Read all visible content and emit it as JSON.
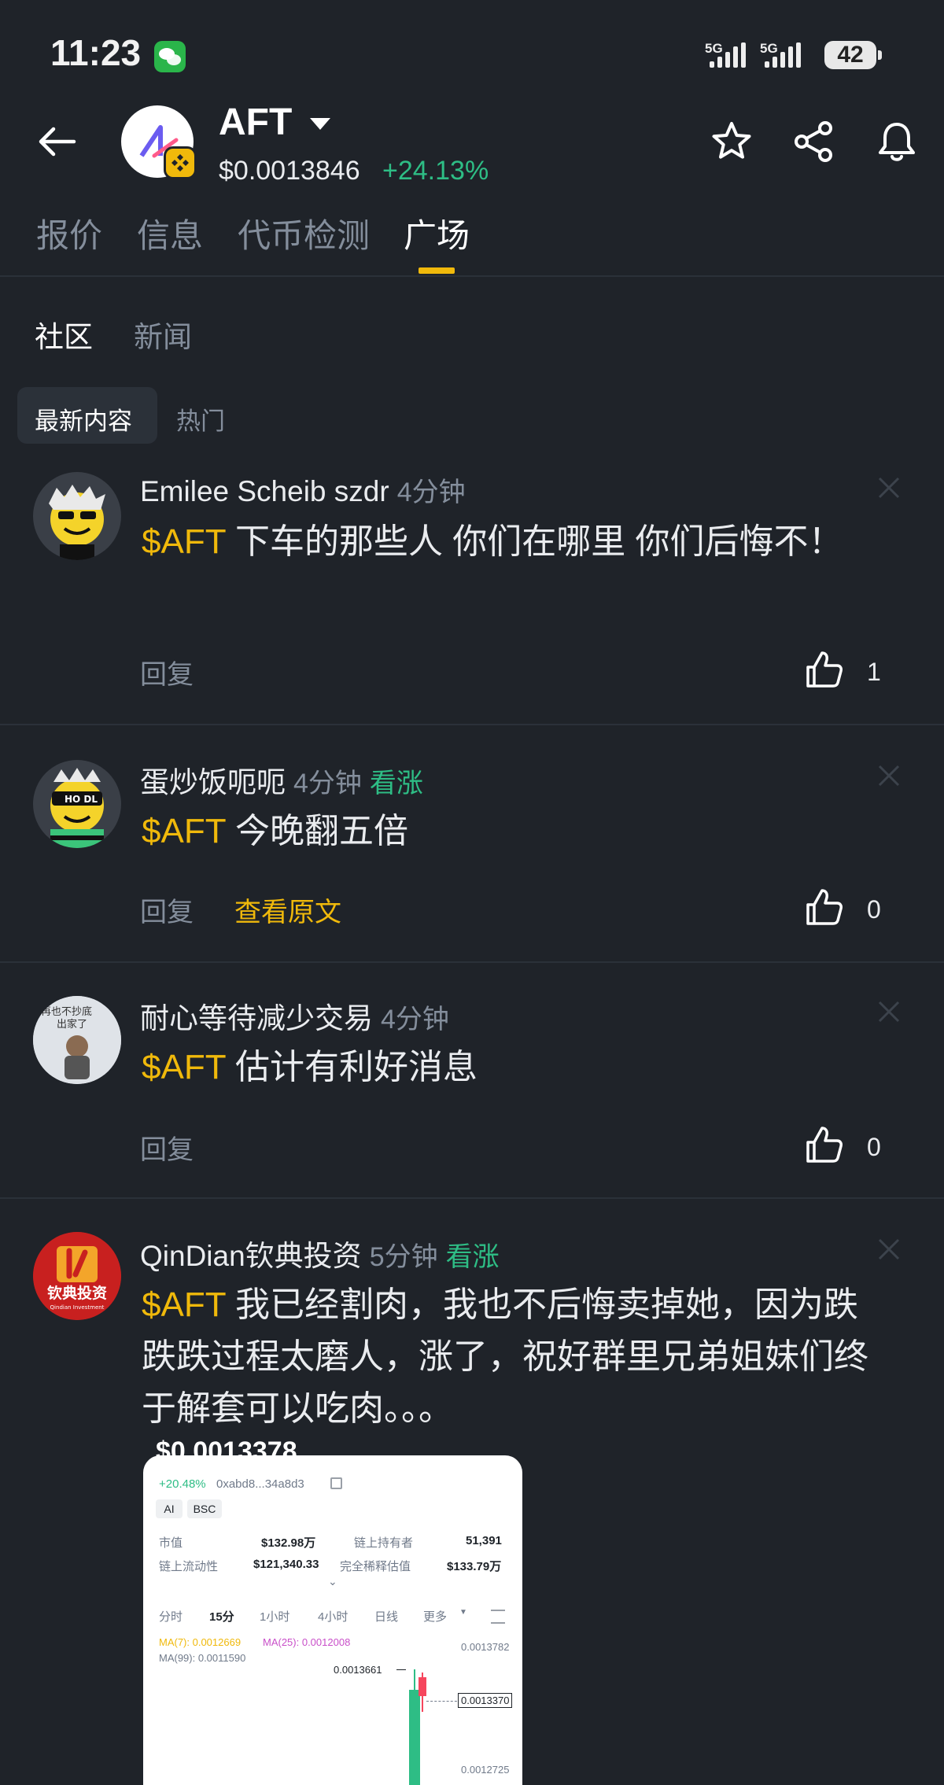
{
  "status_bar": {
    "time": "11:23",
    "network1": "5G",
    "network2": "5G",
    "battery": "42"
  },
  "header": {
    "token": "AFT",
    "price": "$0.0013846",
    "change": "+24.13%"
  },
  "tabs": [
    "报价",
    "信息",
    "代币检测",
    "广场"
  ],
  "subtabs": [
    "社区",
    "新闻"
  ],
  "filters": [
    "最新内容",
    "热门"
  ],
  "posts": [
    {
      "user": "Emilee Scheib szdr",
      "time": "4分钟",
      "tag": "",
      "cashtag": "$AFT",
      "text": " 下车的那些人 你们在哪里   你们后悔不！",
      "reply": "回复",
      "view_original": "",
      "likes": "1"
    },
    {
      "user": "蛋炒饭呃呃",
      "time": "4分钟",
      "tag": "看涨",
      "cashtag": "$AFT",
      "text": " 今晚翻五倍",
      "reply": "回复",
      "view_original": "查看原文",
      "likes": "0"
    },
    {
      "user": "耐心等待减少交易",
      "time": "4分钟",
      "tag": "",
      "cashtag": "$AFT",
      "text": " 估计有利好消息",
      "reply": "回复",
      "view_original": "",
      "likes": "0"
    },
    {
      "user": "QinDian钦典投资",
      "time": "5分钟",
      "tag": "看涨",
      "cashtag": "$AFT",
      "text": " 我已经割肉，我也不后悔卖掉她，因为跌跌跌过程太磨人，涨了，祝好群里兄弟姐妹们终于解套可以吃肉。。。"
    }
  ],
  "attachment": {
    "price_top": "$0.0013378",
    "change": "+20.48%",
    "address": "0xabd8...34a8d3",
    "badges": [
      "AI",
      "BSC"
    ],
    "stats": [
      {
        "label": "市值",
        "value": "$132.98万"
      },
      {
        "label": "链上持有者",
        "value": "51,391"
      },
      {
        "label": "链上流动性",
        "value": "$121,340.33"
      },
      {
        "label": "完全稀释估值",
        "value": "$133.79万"
      }
    ],
    "intervals": [
      "分时",
      "15分",
      "1小时",
      "4小时",
      "日线",
      "更多"
    ],
    "ma7": "MA(7): 0.0012669",
    "ma25": "MA(25): 0.0012008",
    "ma99": "MA(99): 0.0011590",
    "high_label": "0.0013661",
    "axis_top": "0.0013782",
    "current": "0.0013370",
    "axis_bottom": "0.0012725"
  },
  "avatar4_text": "钦典投资",
  "avatar4_sub": "Qindian Investment",
  "avatar3_text1": "再也不抄底",
  "avatar3_text2": "出家了",
  "colors": {
    "accent": "#f0b90b",
    "up": "#2ebd85",
    "bg": "#1f2329"
  }
}
